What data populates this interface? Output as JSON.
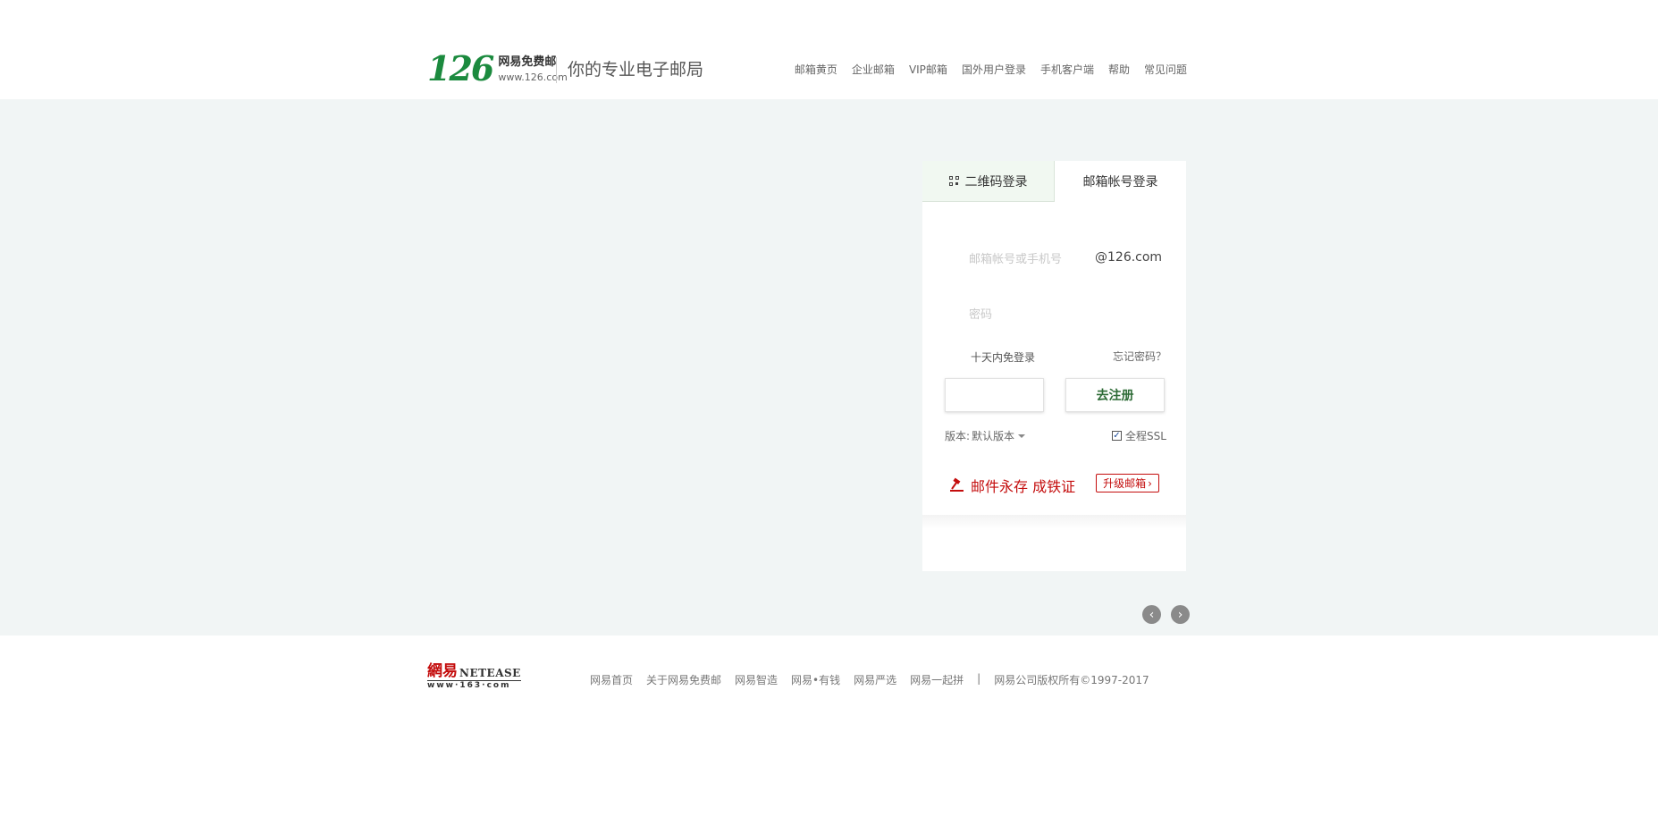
{
  "header": {
    "logo_number": "126",
    "logo_cn": "网易免费邮",
    "logo_url": "www.126.com",
    "slogan": "你的专业电子邮局",
    "nav": [
      "邮箱黄页",
      "企业邮箱",
      "VIP邮箱",
      "国外用户登录",
      "手机客户端",
      "帮助",
      "常见问题"
    ]
  },
  "login": {
    "tab_qr": "二维码登录",
    "tab_account": "邮箱帐号登录",
    "account_placeholder": "邮箱帐号或手机号",
    "domain_suffix": "@126.com",
    "password_placeholder": "密码",
    "remember_label": "十天内免登录",
    "forgot_label": "忘记密码？",
    "login_button": "",
    "register_button": "去注册",
    "version_label": "版本:",
    "version_value": "默认版本",
    "ssl_label": "全程SSL",
    "ssl_checked": true,
    "promo_text": "邮件永存 成铁证",
    "upgrade_button": "升级邮箱"
  },
  "footer": {
    "logo_cn": "網易",
    "logo_en": "NETEASE",
    "logo_url": "www·163·com",
    "links": [
      "网易首页",
      "关于网易免费邮",
      "网易智造",
      "网易•有钱",
      "网易严选",
      "网易一起拼"
    ],
    "separator": "|",
    "copyright": "网易公司版权所有©1997-2017"
  },
  "colors": {
    "brand_green": "#1b8a3e",
    "band_bg": "#f1f5f5",
    "promo_red": "#c40d0d"
  }
}
